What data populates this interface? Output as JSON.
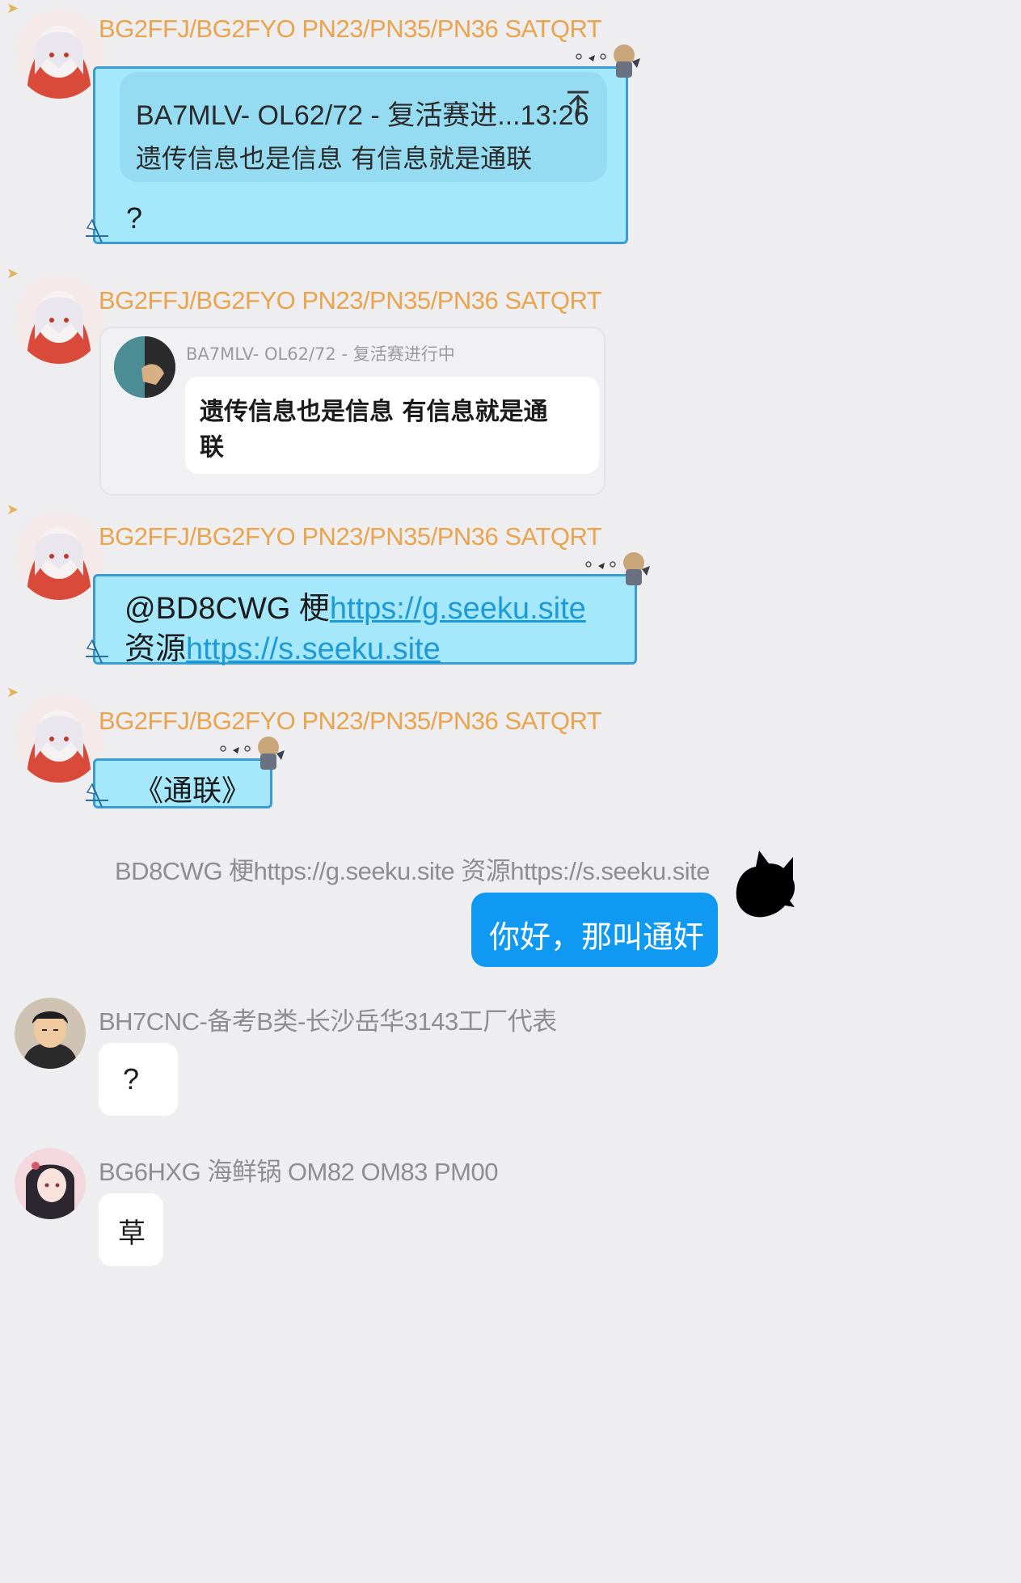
{
  "colors": {
    "background": "#eeeef1",
    "sender_orange": "#e9a44d",
    "sender_gray": "#8d8d93",
    "bubble_cyan": "#a6e8fb",
    "bubble_border": "#3a9cd0",
    "reply_box": "#95dcf2",
    "self_bubble": "#0f99f3",
    "link": "#1e9ad6"
  },
  "messages": [
    {
      "sender": "BG2FFJ/BG2FYO PN23/PN35/PN36 SATQRT",
      "reply_header": "BA7MLV- OL62/72 - 复活赛进...13:26",
      "reply_text": "遗传信息也是信息 有信息就是通联",
      "body": "?",
      "arrow_icon": "up-arrow-icon"
    },
    {
      "sender": "BG2FFJ/BG2FYO PN23/PN35/PN36 SATQRT",
      "quoted_sender": "BA7MLV- OL62/72 - 复活赛进行中",
      "quoted_text_line1": "遗传信息也是信息 有信息就是通",
      "quoted_text_line2": "联"
    },
    {
      "sender": "BG2FFJ/BG2FYO PN23/PN35/PN36 SATQRT",
      "line1_prefix": "@BD8CWG 梗",
      "line1_link": "https://g.seeku.site",
      "line2_prefix": "资源",
      "line2_link": "https://s.seeku.site"
    },
    {
      "sender": "BG2FFJ/BG2FYO PN23/PN35/PN36 SATQRT",
      "body": "《通联》"
    },
    {
      "sender": "BD8CWG 梗https://g.seeku.site  资源https://s.seeku.site",
      "body": "你好，那叫通奸"
    },
    {
      "sender": "BH7CNC-备考B类-长沙岳华3143工厂代表",
      "body": "?"
    },
    {
      "sender": "BG6HXG 海鲜锅 OM82 OM83 PM00",
      "body": "草"
    }
  ]
}
